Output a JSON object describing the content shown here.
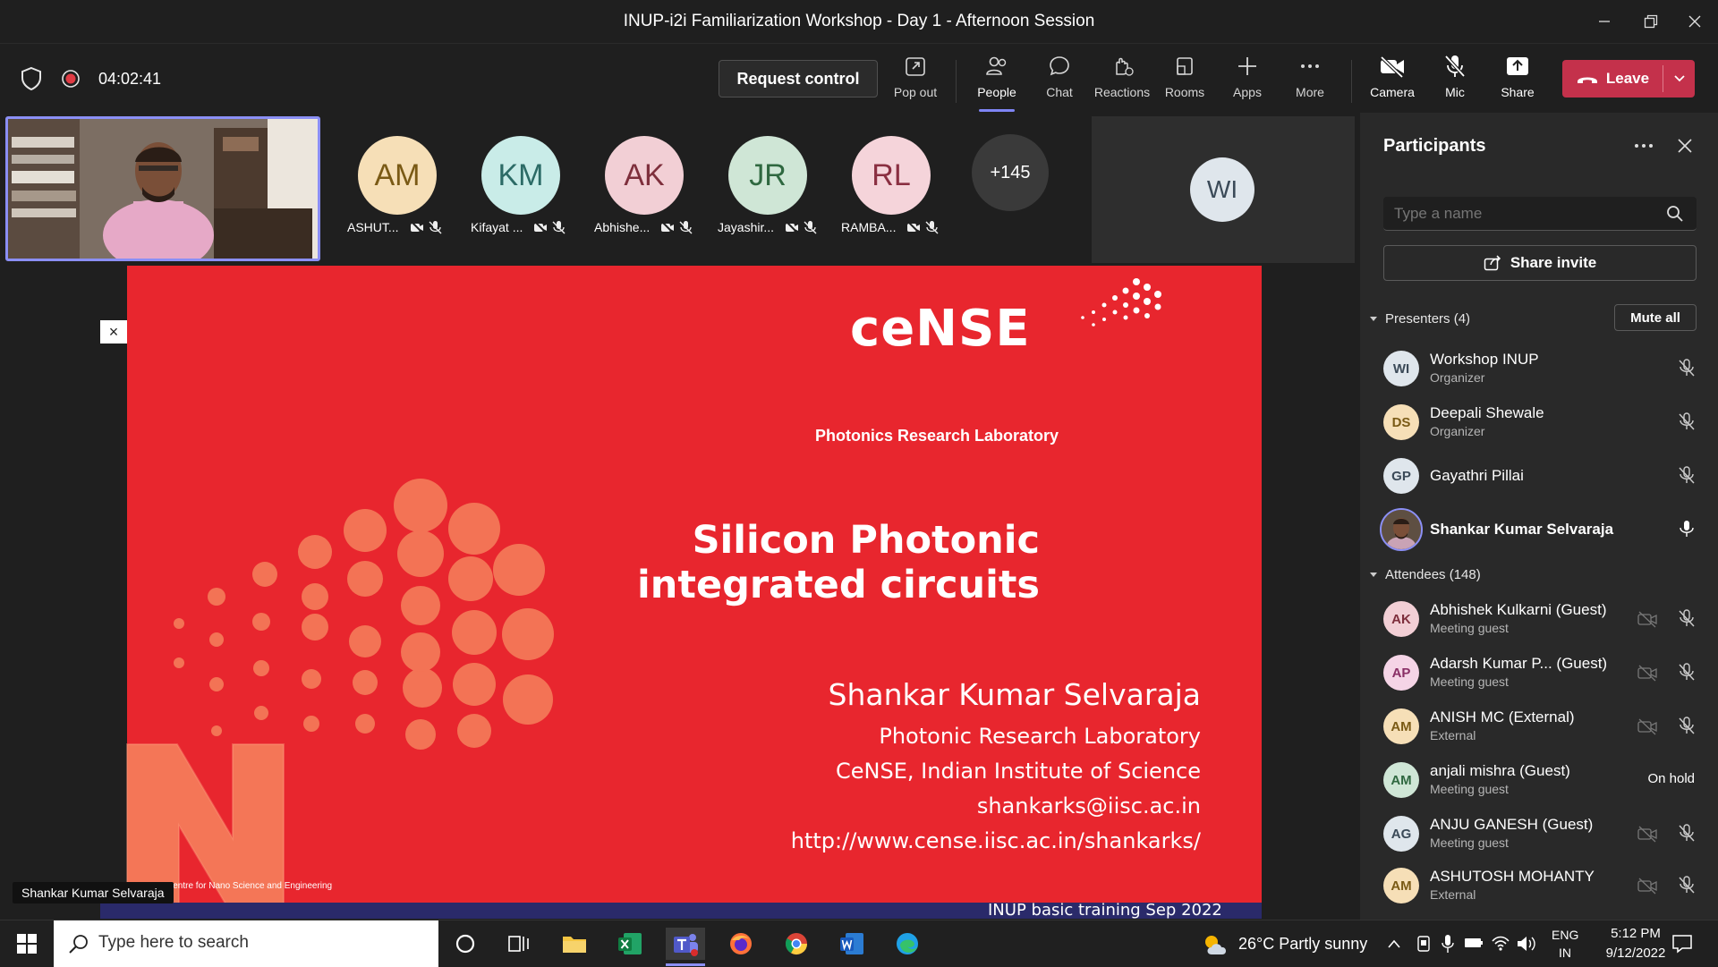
{
  "window": {
    "title": "INUP-i2i Familiarization Workshop - Day 1 - Afternoon Session"
  },
  "toolbar": {
    "timer": "04:02:41",
    "request_control": "Request control",
    "items": [
      {
        "label": "Pop out",
        "icon": "pop-out-icon"
      },
      {
        "label": "People",
        "icon": "people-icon"
      },
      {
        "label": "Chat",
        "icon": "chat-icon"
      },
      {
        "label": "Reactions",
        "icon": "reactions-icon"
      },
      {
        "label": "Rooms",
        "icon": "rooms-icon"
      },
      {
        "label": "Apps",
        "icon": "apps-icon"
      },
      {
        "label": "More",
        "icon": "more-icon"
      },
      {
        "label": "Camera",
        "icon": "camera-off-icon"
      },
      {
        "label": "Mic",
        "icon": "mic-off-icon"
      },
      {
        "label": "Share",
        "icon": "share-icon"
      }
    ],
    "leave": "Leave"
  },
  "gallery": {
    "tiles": [
      {
        "initials": "AM",
        "name": "ASHUT...",
        "bg": "#f6dfb7",
        "fg": "#7a5a15"
      },
      {
        "initials": "KM",
        "name": "Kifayat ...",
        "bg": "#c9ece8",
        "fg": "#2c6b66"
      },
      {
        "initials": "AK",
        "name": "Abhishe...",
        "bg": "#f2cfd5",
        "fg": "#7e2f3c"
      },
      {
        "initials": "JR",
        "name": "Jayashir...",
        "bg": "#cfe6d6",
        "fg": "#2f6840"
      },
      {
        "initials": "RL",
        "name": "RAMBA...",
        "bg": "#f5d4da",
        "fg": "#8a2f41"
      }
    ],
    "overflow": "+145",
    "large_tile_initials": "WI",
    "presenter_label": "Shankar Kumar Selvaraja"
  },
  "slide": {
    "logo": "ceNSE",
    "lab": "Photonics Research Laboratory",
    "title": "Silicon Photonic integrated circuits",
    "author": "Shankar Kumar Selvaraja",
    "affil1": "Photonic Research Laboratory",
    "affil2": "CeNSE, Indian Institute of Science",
    "email": "shankarks@iisc.ac.in",
    "url": "http://www.cense.iisc.ac.in/shankarks/",
    "footer_small": "Centre for Nano Science and Engineering",
    "footer": "INUP basic training Sep 2022",
    "close": "×"
  },
  "panel": {
    "title": "Participants",
    "search_placeholder": "Type a name",
    "share_invite": "Share invite",
    "presenters_header": "Presenters (4)",
    "mute_all": "Mute all",
    "attendees_header": "Attendees (148)",
    "presenters": [
      {
        "initials": "WI",
        "name": "Workshop INUP",
        "role": "Organizer",
        "bg": "#dfe6ec",
        "mic": "muted"
      },
      {
        "initials": "DS",
        "name": "Deepali Shewale",
        "role": "Organizer",
        "bg": "#f6dfb7",
        "mic": "muted"
      },
      {
        "initials": "GP",
        "name": "Gayathri Pillai",
        "role": "",
        "bg": "#dfe6ec",
        "mic": "muted"
      },
      {
        "initials": "",
        "name": "Shankar Kumar Selvaraja",
        "role": "",
        "bg": "#6b5a4a",
        "mic": "on"
      }
    ],
    "attendees": [
      {
        "initials": "AK",
        "name": "Abhishek Kulkarni (Guest)",
        "role": "Meeting guest",
        "bg": "#f2cfd5",
        "status": ""
      },
      {
        "initials": "AP",
        "name": "Adarsh Kumar P...  (Guest)",
        "role": "Meeting guest",
        "bg": "#f5d4e6",
        "status": ""
      },
      {
        "initials": "AM",
        "name": "ANISH MC (External)",
        "role": "External",
        "bg": "#f6dfb7",
        "status": ""
      },
      {
        "initials": "AM",
        "name": "anjali mishra (Guest)",
        "role": "Meeting guest",
        "bg": "#cfe6d6",
        "status": "On hold"
      },
      {
        "initials": "AG",
        "name": "ANJU GANESH (Guest)",
        "role": "Meeting guest",
        "bg": "#dfe6ec",
        "status": ""
      },
      {
        "initials": "AM",
        "name": "ASHUTOSH MOHANTY",
        "role": "External",
        "bg": "#f6dfb7",
        "status": ""
      }
    ]
  },
  "taskbar": {
    "search_placeholder": "Type here to search",
    "weather": "26°C  Partly sunny",
    "lang1": "ENG",
    "lang2": "IN",
    "time": "5:12 PM",
    "date": "9/12/2022"
  }
}
